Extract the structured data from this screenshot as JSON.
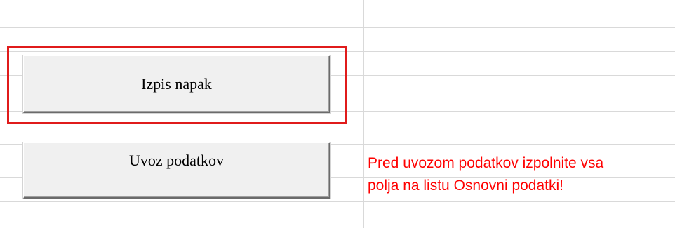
{
  "buttons": {
    "izpis_label": "Izpis napak",
    "uvoz_label": "Uvoz podatkov"
  },
  "warning": {
    "line1": "Pred uvozom podatkov izpolnite vsa",
    "line2": "polja na listu Osnovni podatki!"
  },
  "colors": {
    "highlight": "#e01b1b",
    "warning_text": "#ff0000",
    "gridline": "#d9d9d9",
    "button_face": "#f0f0f0"
  }
}
